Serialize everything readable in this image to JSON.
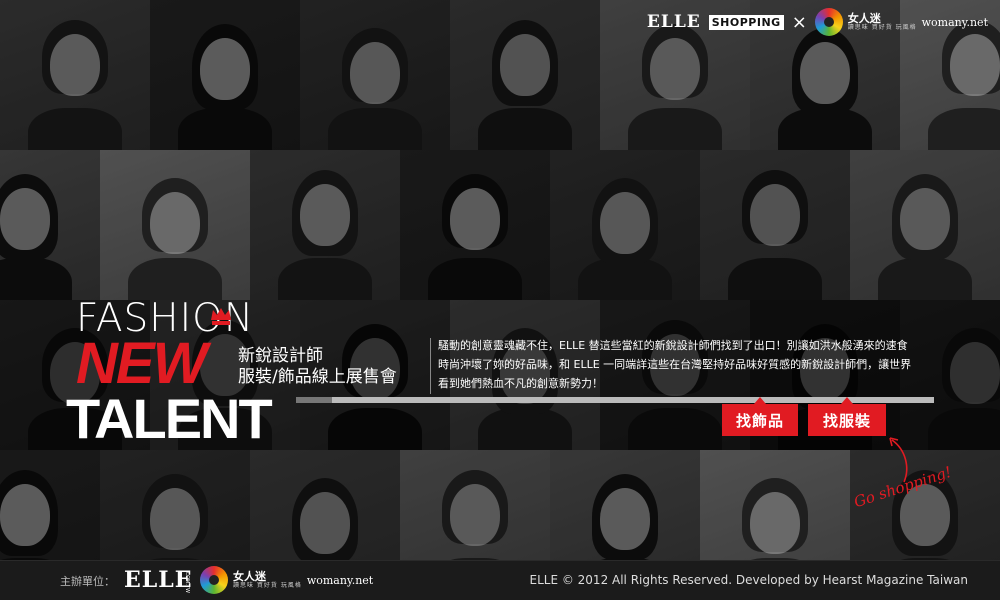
{
  "header": {
    "elle_logo": "ELLE",
    "shopping_label": "SHOPPING",
    "times": "×",
    "womany_name": "女人迷",
    "womany_sub": "讀思味 買好貨 玩風格",
    "womany_domain": "womany.net"
  },
  "title": {
    "fashion": "FASHION",
    "new": "NEW",
    "talent": "TALENT",
    "subtitle_line1": "新銳設計師",
    "subtitle_line2": "服裝/飾品線上展售會"
  },
  "description": "騷動的創意靈魂藏不住，ELLE 替這些當紅的新銳設計師們找到了出口！別讓如洪水般湧來的速食時尚沖壞了妳的好品味，和 ELLE 一同端詳這些在台灣堅持好品味好質感的新銳設計師們，讓世界看到她們熱血不凡的創意新勢力！",
  "buttons": {
    "accessories": "找飾品",
    "clothing": "找服裝"
  },
  "go_shopping": "Go shopping!",
  "footer": {
    "host_label": "主辦單位：",
    "elle_logo": "ELLE",
    "elle_sub": ".COM.TW",
    "womany_name": "女人迷",
    "womany_sub": "讀思味 買好貨 玩風格",
    "womany_domain": "womany.net",
    "copyright": "ELLE © 2012 All Rights Reserved. Developed by Hearst Magazine Taiwan"
  },
  "colors": {
    "accent": "#e11b22",
    "background": "#1a1a1a"
  }
}
